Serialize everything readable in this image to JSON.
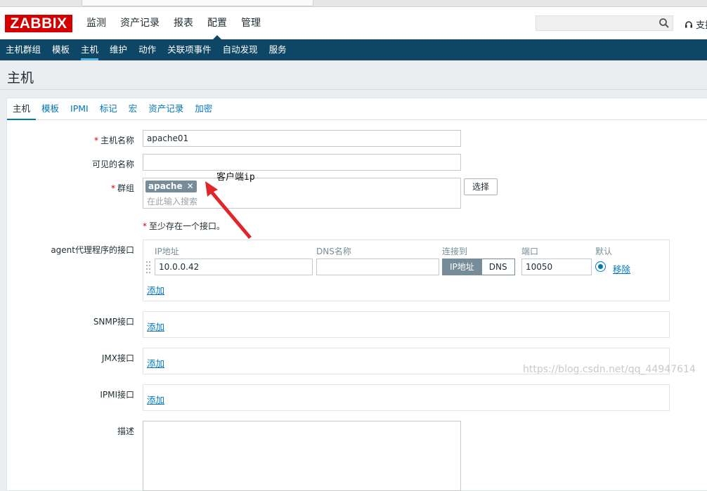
{
  "topbar": {
    "logo": "ZABBIX",
    "menu": [
      "监测",
      "资产记录",
      "报表",
      "配置",
      "管理"
    ],
    "active_menu": "配置",
    "support_label": "支持"
  },
  "submenu": {
    "items": [
      "主机群组",
      "模板",
      "主机",
      "维护",
      "动作",
      "关联项事件",
      "自动发现",
      "服务"
    ],
    "active": "主机"
  },
  "page": {
    "title": "主机"
  },
  "tabs": {
    "items": [
      "主机",
      "模板",
      "IPMI",
      "标记",
      "宏",
      "资产记录",
      "加密"
    ],
    "active": "主机"
  },
  "form": {
    "host_name_label": "主机名称",
    "host_name_value": "apache01",
    "visible_name_label": "可见的名称",
    "visible_name_value": "",
    "groups_label": "群组",
    "group_chip": "apache",
    "group_placeholder": "在此输入搜索",
    "select_button": "选择",
    "required_star": "*",
    "interface_note": "至少存在一个接口。",
    "agent_label": "agent代理程序的接口",
    "snmp_label": "SNMP接口",
    "jmx_label": "JMX接口",
    "ipmi_label": "IPMI接口",
    "description_label": "描述"
  },
  "interface": {
    "headers": {
      "ip": "IP地址",
      "dns": "DNS名称",
      "connect": "连接到",
      "port": "端口",
      "default": "默认"
    },
    "ip_value": "10.0.0.42",
    "dns_value": "",
    "connect_options": [
      "IP地址",
      "DNS"
    ],
    "connect_selected": "IP地址",
    "port_value": "10050",
    "remove_link": "移除",
    "add_link": "添加"
  },
  "annotation": {
    "text": "客户端ip",
    "color": "#e0262a"
  },
  "watermark": "https://blog.csdn.net/qq_44947614",
  "colors": {
    "brand_red": "#d40000",
    "nav_blue": "#0e4766",
    "link_blue": "#0275b8",
    "segment_gray": "#768d99"
  }
}
